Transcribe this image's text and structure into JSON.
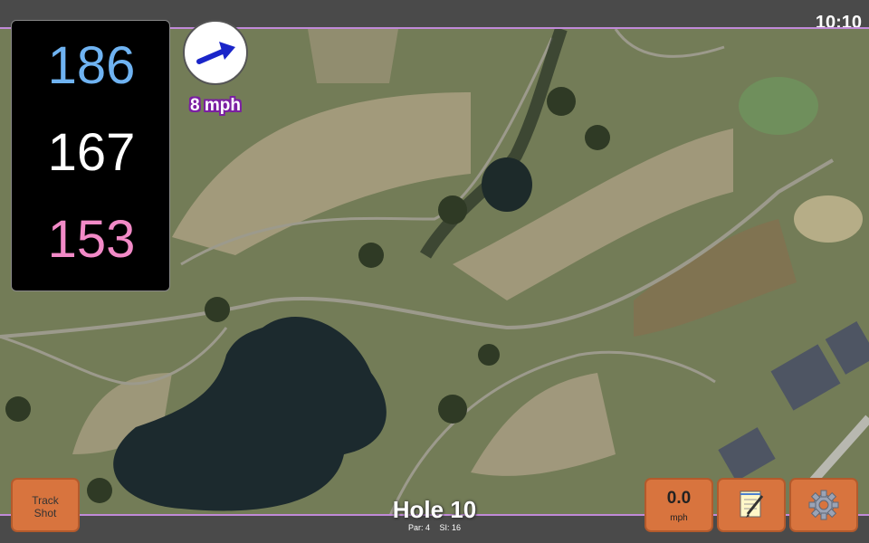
{
  "status_bar": {
    "time": "10:10"
  },
  "distances": {
    "back": "186",
    "middle": "167",
    "front": "153",
    "colors": {
      "back": "#6fb3f2",
      "middle": "#ffffff",
      "front": "#f28ac7"
    }
  },
  "wind": {
    "speed": "8 mph",
    "arrow_color": "#1a25c9",
    "direction_icon": "arrow-up-right-icon"
  },
  "buttons": {
    "track_shot_line1": "Track",
    "track_shot_line2": "Shot",
    "speed_value": "0.0",
    "speed_unit": "mph",
    "notes_icon": "notepad-icon",
    "settings_icon": "gear-icon",
    "accent": "#d8743e"
  },
  "hole": {
    "title": "Hole 10",
    "par": "Par: 4",
    "si": "SI: 16"
  }
}
